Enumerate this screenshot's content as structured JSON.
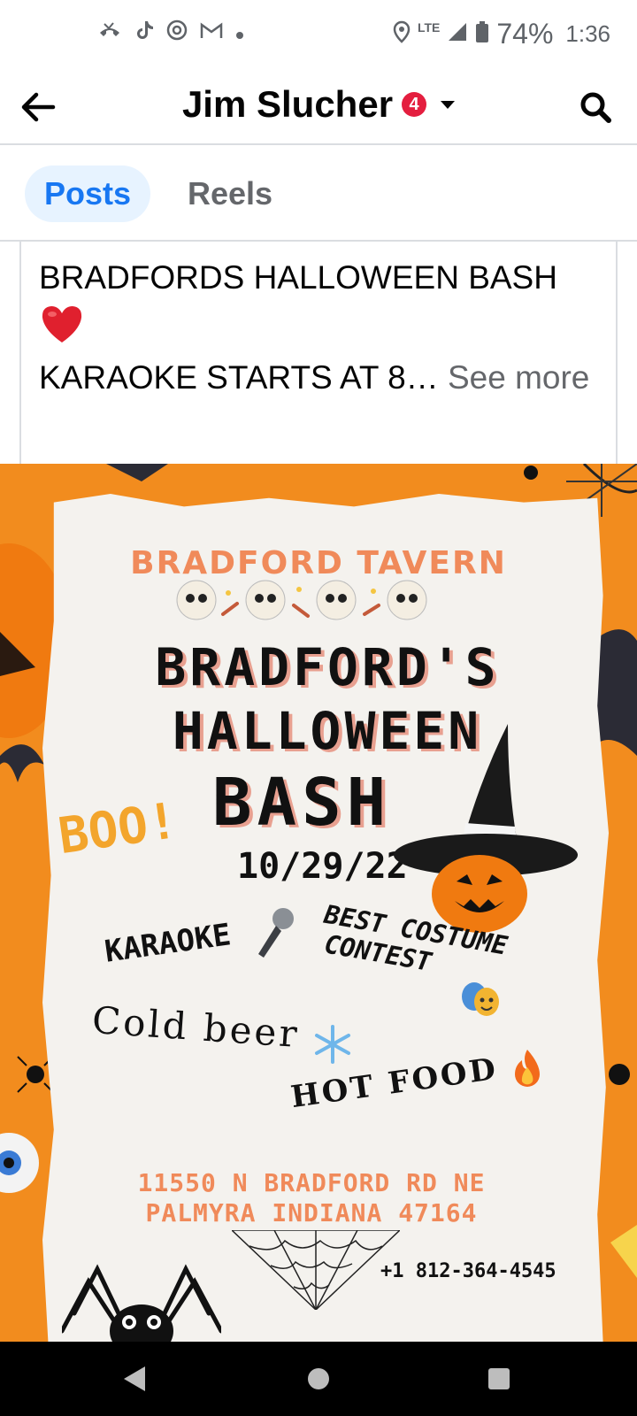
{
  "status_bar": {
    "time": "1:36",
    "battery_percent": "74%",
    "network": "LTE",
    "notification_icons": [
      "missed-call-icon",
      "tiktok-icon",
      "threads-icon",
      "gmail-icon",
      "dot-icon"
    ]
  },
  "header": {
    "title": "Jim Slucher",
    "badge_count": "4"
  },
  "tabs": [
    {
      "label": "Posts",
      "selected": true
    },
    {
      "label": "Reels",
      "selected": false
    }
  ],
  "post": {
    "line1": "BRADFORDS HALLOWEEN BASH",
    "line2": "KARAOKE STARTS AT 8…",
    "see_more": "See more"
  },
  "flyer": {
    "venue": "BRADFORD TAVERN",
    "headline_1": "BRADFORD'S",
    "headline_2": "HALLOWEEN",
    "headline_3": "BASH",
    "boo": "BOO!",
    "date": "10/29/22",
    "karaoke": "KARAOKE",
    "costume_1": "BEST COSTUME",
    "costume_2": "CONTEST",
    "beer": "Cold beer",
    "food": "HOT FOOD",
    "address_1": "11550 N BRADFORD RD NE",
    "address_2": "PALMYRA INDIANA 47164",
    "phone": "+1 812-364-4545"
  },
  "colors": {
    "facebook_blue": "#1877f2",
    "tab_selected_bg": "#e7f3ff",
    "badge_red": "#e41e3f",
    "flyer_orange": "#f28c1e",
    "flyer_salmon": "#f08a5a"
  }
}
